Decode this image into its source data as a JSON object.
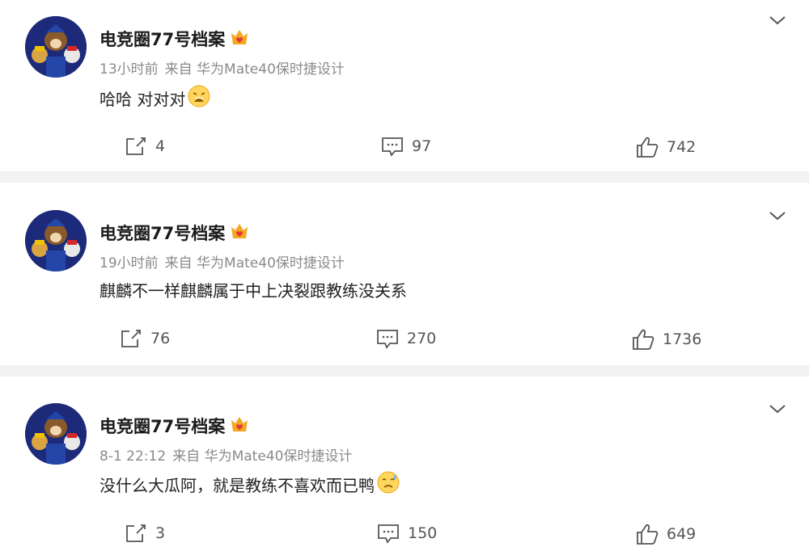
{
  "posts": [
    {
      "username": "电竞圈77号档案",
      "time": "13小时前",
      "source": "来自 华为Mate40保时捷设计",
      "content": "哈哈 对对对",
      "emoji": "tired-face-emoji",
      "shares": "4",
      "comments": "97",
      "likes": "742"
    },
    {
      "username": "电竞圈77号档案",
      "time": "19小时前",
      "source": "来自 华为Mate40保时捷设计",
      "content": "麒麟不一样麒麟属于中上决裂跟教练没关系",
      "emoji": "",
      "shares": "76",
      "comments": "270",
      "likes": "1736"
    },
    {
      "username": "电竞圈77号档案",
      "time": "8-1 22:12",
      "source": "来自 华为Mate40保时捷设计",
      "content": "没什么大瓜阿，就是教练不喜欢而已鸭",
      "emoji": "sad-sweat-emoji",
      "shares": "3",
      "comments": "150",
      "likes": "649"
    }
  ],
  "icons": {
    "share": "share-icon",
    "comment": "comment-icon",
    "like": "thumbs-up-icon",
    "menu": "chevron-down-icon",
    "vip": "crown-heart-icon"
  },
  "colors": {
    "username": "#1a1a1a",
    "meta": "#8a8a8a",
    "separator": "#f2f2f2",
    "badge": "#f5a623"
  }
}
